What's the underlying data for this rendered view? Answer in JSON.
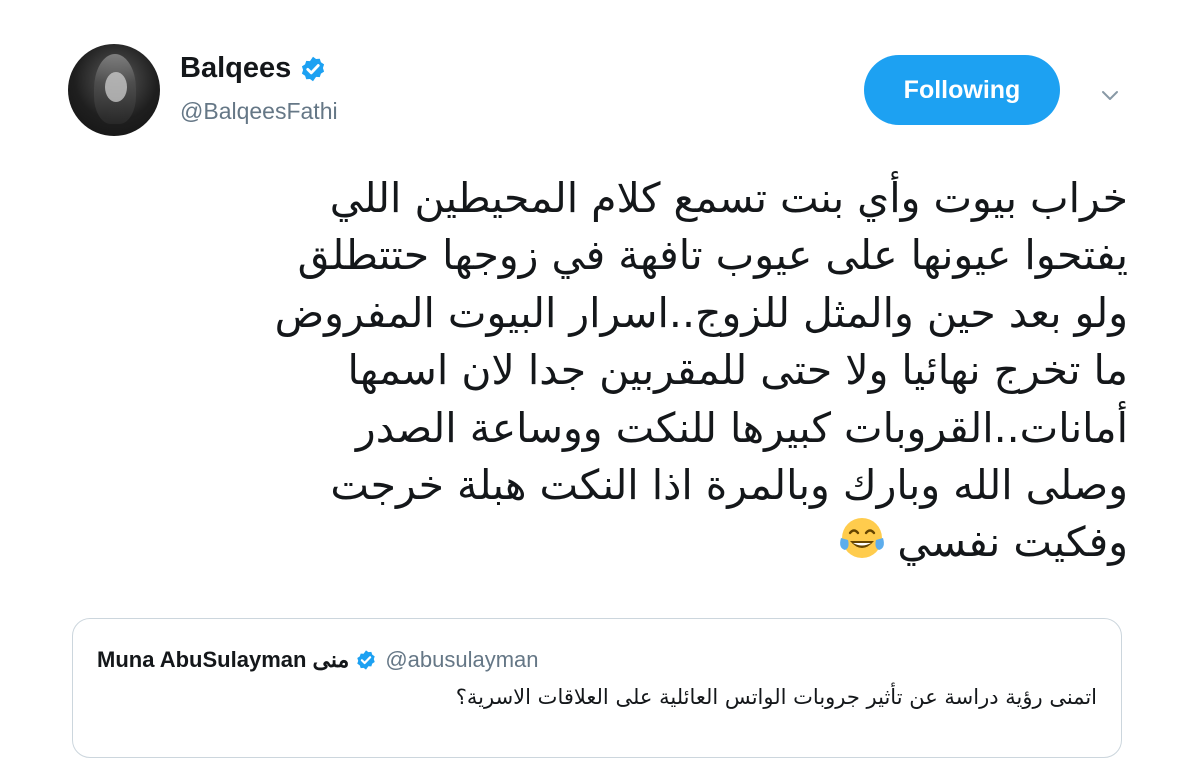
{
  "author": {
    "display_name": "Balqees",
    "handle": "@BalqeesFathi",
    "verified": true,
    "avatar_icon": "profile-photo"
  },
  "follow_button": {
    "label": "Following",
    "color": "#1da1f2"
  },
  "menu_icon": "chevron-down-icon",
  "tweet": {
    "lines": [
      "خراب بيوت وأي بنت تسمع كلام المحيطين اللي",
      "يفتحوا عيونها على عيوب تافهة في زوجها حتتطلق",
      "ولو بعد حين والمثل للزوج..اسرار البيوت المفروض",
      "ما تخرج نهائيا ولا حتى للمقربين جدا لان اسمها",
      "أمانات..القروبات كبيرها للنكت ووساعة الصدر",
      "وصلى الله وبارك وبالمرة اذا النكت هبلة خرجت",
      "وفكيت نفسي"
    ],
    "emoji": "face-with-tears-of-joy"
  },
  "quoted_tweet": {
    "display_name": "Muna AbuSulayman منى",
    "handle": "@abusulayman",
    "verified": true,
    "text": "اتمنى رؤية دراسة عن تأثير جروبات الواتس العائلية على العلاقات الاسرية؟"
  },
  "colors": {
    "accent": "#1da1f2",
    "verified": "#1da1f2",
    "secondary_text": "#657786"
  }
}
